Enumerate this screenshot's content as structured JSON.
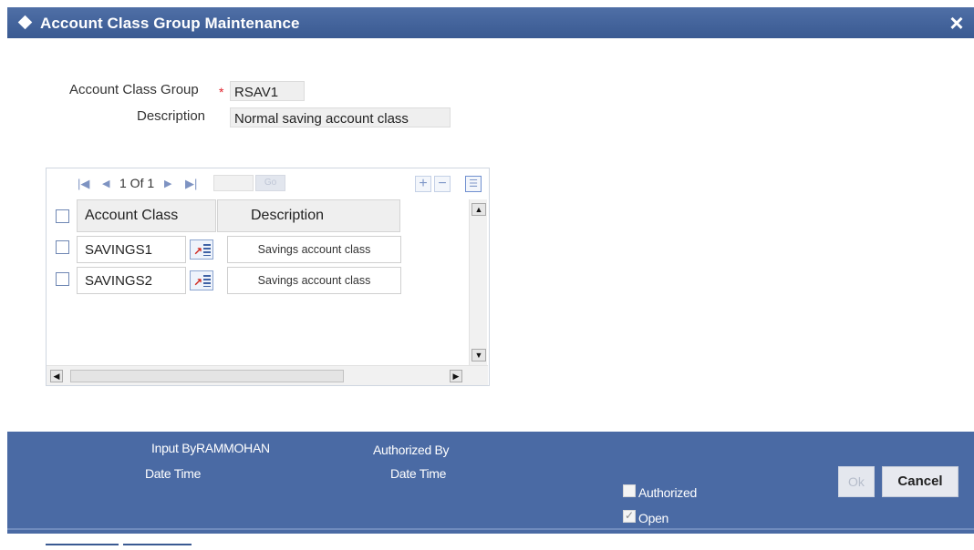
{
  "window": {
    "title": "Account Class Group Maintenance"
  },
  "form": {
    "group_label": "Account Class Group",
    "group_required_mark": "*",
    "group_value": "RSAV1",
    "description_label": "Description",
    "description_value": "Normal saving account class"
  },
  "grid": {
    "pager": {
      "text": "1 Of 1",
      "go_label": "Go"
    },
    "columns": [
      "Account Class",
      "Description"
    ],
    "rows": [
      {
        "account_class": "SAVINGS1",
        "description": "Savings account class"
      },
      {
        "account_class": "SAVINGS2",
        "description": "Savings account class"
      }
    ]
  },
  "footer": {
    "input_by_label": "Input By",
    "input_by_value": "RAMMOHAN",
    "date_time_label": "Date Time",
    "authorized_by_label": "Authorized By",
    "date_time_label_2": "Date Time",
    "authorized_label": "Authorized",
    "authorized_checked": false,
    "open_label": "Open",
    "open_checked": true,
    "ok_label": "Ok",
    "cancel_label": "Cancel"
  },
  "colors": {
    "header_blue": "#3a5a92",
    "footer_blue": "#4a6aa4",
    "required_red": "#e0202a"
  }
}
